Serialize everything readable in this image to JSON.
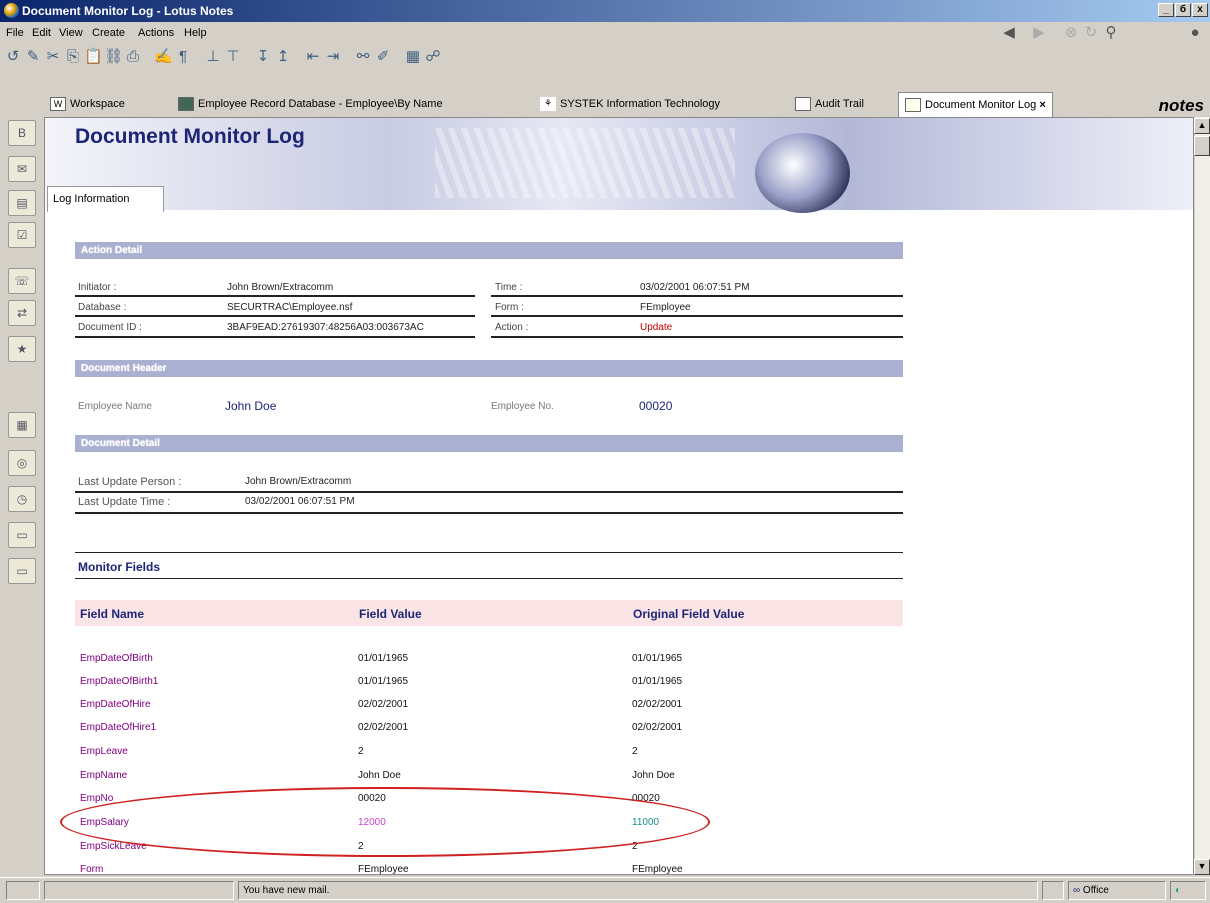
{
  "window": {
    "title": "Document Monitor Log - Lotus Notes",
    "controls": [
      "_",
      "б",
      "x"
    ]
  },
  "menu": [
    "File",
    "Edit",
    "View",
    "Create",
    "Actions",
    "Help"
  ],
  "tabs": [
    {
      "label": "Workspace",
      "icon": "workspace-icon"
    },
    {
      "label": "Employee Record Database - Employee\\By Name",
      "icon": "database-icon"
    },
    {
      "label": "SYSTEK Information Technology",
      "icon": "web-icon"
    },
    {
      "label": "Audit Trail",
      "icon": "document-icon"
    },
    {
      "label": "Document Monitor Log",
      "icon": "document-icon",
      "active": true
    }
  ],
  "brand": "notes",
  "page": {
    "title": "Document Monitor Log",
    "tab": "Log Information",
    "sections": {
      "action": "Action Detail",
      "header": "Document Header",
      "detail": "Document Detail",
      "monitor": "Monitor Fields"
    },
    "action": {
      "initiator_label": "Initiator :",
      "initiator": "John Brown/Extracomm",
      "database_label": "Database :",
      "database": "SECURTRAC\\Employee.nsf",
      "docid_label": "Document ID :",
      "docid": "3BAF9EAD:27619307:48256A03:003673AC",
      "time_label": "Time :",
      "time": "03/02/2001 06:07:51 PM",
      "form_label": "Form :",
      "form": "FEmployee",
      "action_label": "Action :",
      "action": "Update"
    },
    "header": {
      "name_label": "Employee Name",
      "name": "John Doe",
      "no_label": "Employee No.",
      "no": "00020"
    },
    "detail": {
      "person_label": "Last Update Person :",
      "person": "John Brown/Extracomm",
      "time_label": "Last Update Time :",
      "time": "03/02/2001 06:07:51 PM"
    },
    "monitor_cols": [
      "Field Name",
      "Field Value",
      "Original Field Value"
    ],
    "rows": [
      [
        "EmpDateOfBirth",
        "01/01/1965",
        "01/01/1965"
      ],
      [
        "EmpDateOfBirth1",
        "01/01/1965",
        "01/01/1965"
      ],
      [
        "EmpDateOfHire",
        "02/02/2001",
        "02/02/2001"
      ],
      [
        "EmpDateOfHire1",
        "02/02/2001",
        "02/02/2001"
      ],
      [
        "EmpLeave",
        "2",
        "2"
      ],
      [
        "EmpName",
        "John Doe",
        "John Doe"
      ],
      [
        "EmpNo",
        "00020",
        "00020"
      ],
      [
        "EmpSalary",
        "12000",
        "11000"
      ],
      [
        "EmpSickLeave",
        "2",
        "2"
      ],
      [
        "Form",
        "FEmployee",
        "FEmployee"
      ]
    ]
  },
  "status": {
    "message": "You have new mail.",
    "location": "Office"
  },
  "colors": {
    "accent": "#1c2577",
    "section": "#aab0d0",
    "highlight": "#d02020",
    "changed": "#cc44cc",
    "original": "#1a9090"
  }
}
